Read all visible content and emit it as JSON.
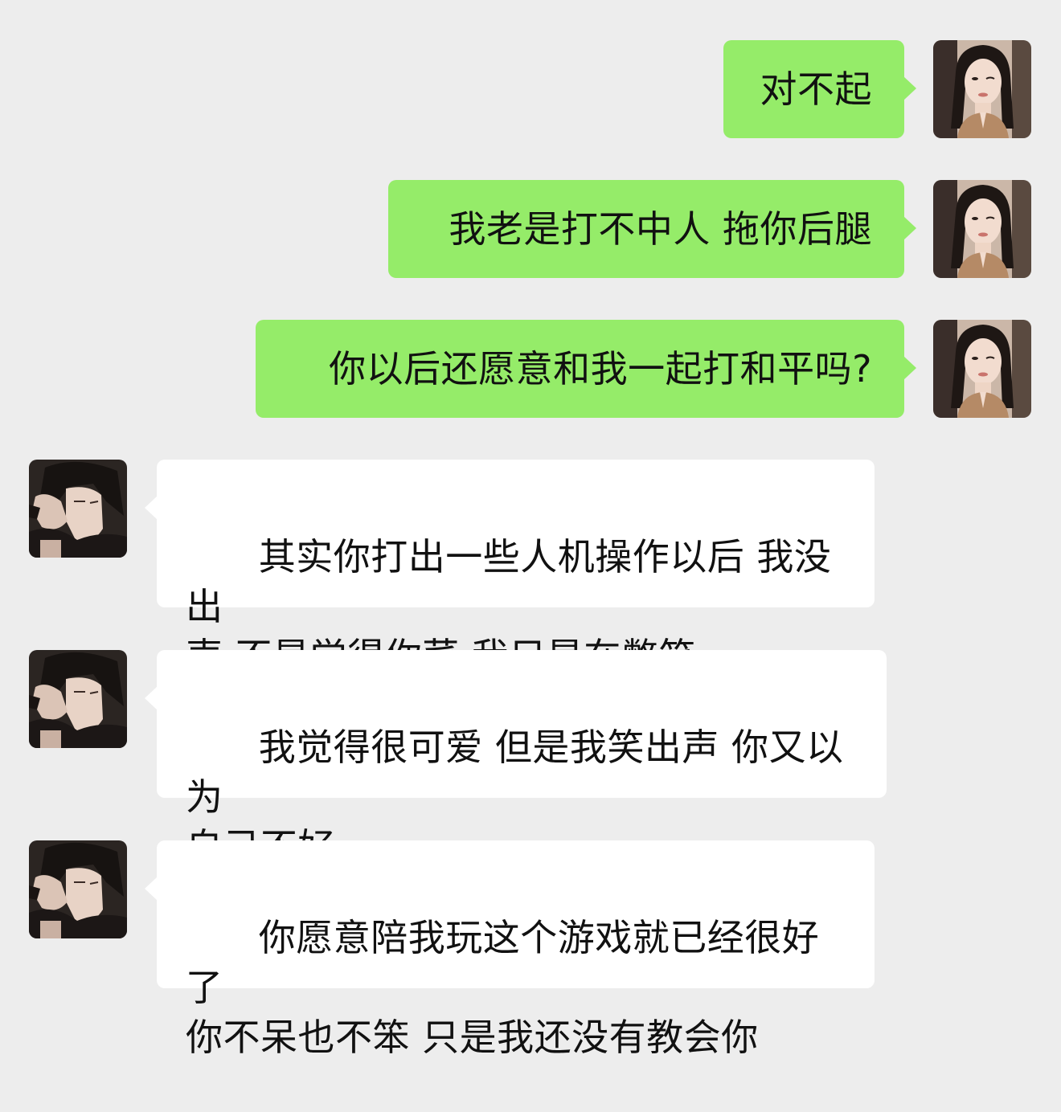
{
  "messages": [
    {
      "side": "out",
      "text": "对不起"
    },
    {
      "side": "out",
      "text": "我老是打不中人 拖你后腿"
    },
    {
      "side": "out",
      "text": "你以后还愿意和我一起打和平吗?"
    },
    {
      "side": "in",
      "text": "其实你打出一些人机操作以后 我没出\n声 不是觉得你菜 我只是在憋笑"
    },
    {
      "side": "in",
      "text": "我觉得很可爱 但是我笑出声 你又以为\n自己不好"
    },
    {
      "side": "in",
      "text": "你愿意陪我玩这个游戏就已经很好了\n你不呆也不笨 只是我还没有教会你"
    }
  ],
  "colors": {
    "background": "#ededed",
    "outgoing_bubble": "#95ec69",
    "incoming_bubble": "#ffffff"
  },
  "icons": {
    "self_avatar": "woman-portrait-avatar",
    "contact_avatar": "dark-haired-man-avatar"
  }
}
